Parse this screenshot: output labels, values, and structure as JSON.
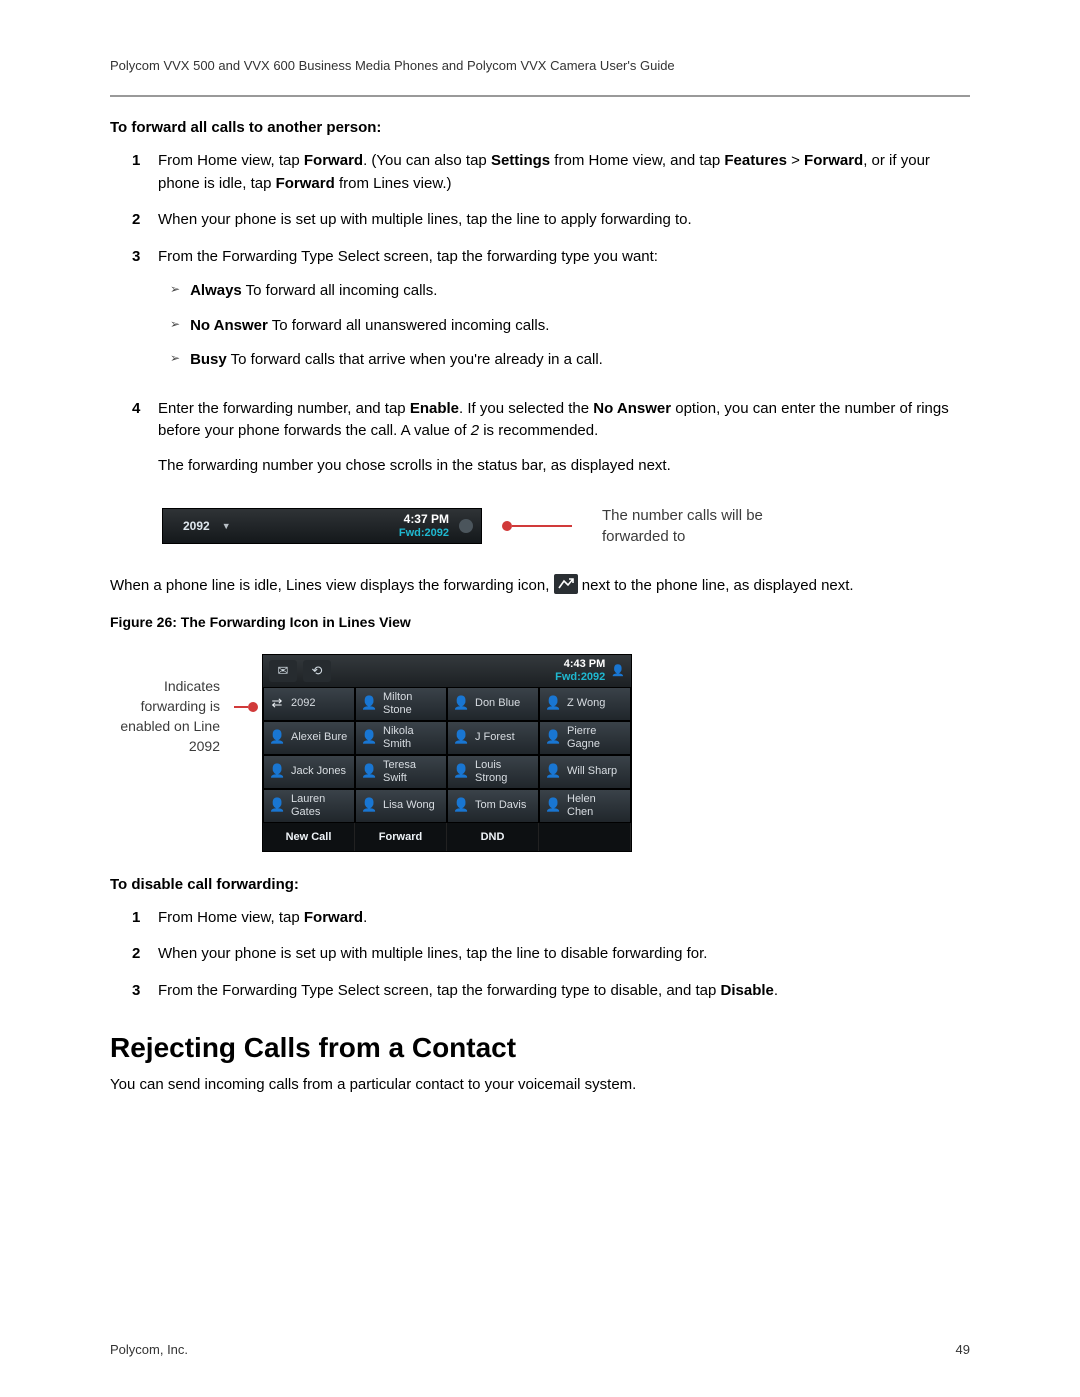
{
  "header": {
    "title": "Polycom VVX 500 and VVX 600 Business Media Phones and Polycom VVX Camera User's Guide"
  },
  "forward_enable": {
    "label": "To forward all calls to another person:",
    "step1_a": "From Home view, tap ",
    "step1_b1": "Forward",
    "step1_c": ". (You can also tap ",
    "step1_b2": "Settings",
    "step1_d": " from Home view, and tap ",
    "step1_b3": "Features",
    "step1_e": " > ",
    "step1_b4": "Forward",
    "step1_f": ", or if your phone is idle, tap ",
    "step1_b5": "Forward",
    "step1_g": " from Lines view.)",
    "step2": "When your phone is set up with multiple lines, tap the line to apply forwarding to.",
    "step3": "From the Forwarding Type Select screen, tap the forwarding type you want:",
    "sub_always_b": "Always",
    "sub_always_t": "    To forward all incoming calls.",
    "sub_noanswer_b": "No Answer",
    "sub_noanswer_t": "    To forward all unanswered incoming calls.",
    "sub_busy_b": "Busy",
    "sub_busy_t": "    To forward calls that arrive when you're already in a call.",
    "step4_a": "Enter the forwarding number, and tap ",
    "step4_b1": "Enable",
    "step4_c": ". If you selected the ",
    "step4_b2": "No Answer",
    "step4_d": " option, you can enter the number of rings before your phone forwards the call. A value of ",
    "step4_i": "2",
    "step4_e": " is recommended.",
    "step4_after": "The forwarding number you chose scrolls in the status bar, as displayed next."
  },
  "statusbar": {
    "ext": "2092",
    "time": "4:37 PM",
    "fwd": "Fwd:2092",
    "callout1": "The number calls will be",
    "callout2": "forwarded to"
  },
  "mid_para_a": "When a phone line is idle, Lines view displays the forwarding icon, ",
  "mid_para_b": " next to the phone line, as displayed next.",
  "figure_caption": "Figure 26: The Forwarding Icon in Lines View",
  "lines_callout": "Indicates forwarding is enabled on Line 2092",
  "phone": {
    "time": "4:43 PM",
    "fwd": "Fwd:2092",
    "softkeys": [
      "New Call",
      "Forward",
      "DND",
      ""
    ],
    "cells": [
      [
        "2092",
        "Milton Stone",
        "Don Blue",
        "Z Wong"
      ],
      [
        "Alexei Bure",
        "Nikola Smith",
        "J Forest",
        "Pierre Gagne"
      ],
      [
        "Jack Jones",
        "Teresa Swift",
        "Louis Strong",
        "Will Sharp"
      ],
      [
        "Lauren Gates",
        "Lisa Wong",
        "Tom Davis",
        "Helen Chen"
      ]
    ]
  },
  "forward_disable": {
    "label": "To disable call forwarding:",
    "step1_a": "From Home view, tap ",
    "step1_b": "Forward",
    "step1_c": ".",
    "step2": "When your phone is set up with multiple lines, tap the line to disable forwarding for.",
    "step3_a": "From the Forwarding Type Select screen, tap the forwarding type to disable, and tap ",
    "step3_b": "Disable",
    "step3_c": "."
  },
  "rejecting": {
    "heading": "Rejecting Calls from a Contact",
    "body": "You can send incoming calls from a particular contact to your voicemail system."
  },
  "footer": {
    "left": "Polycom, Inc.",
    "right": "49"
  }
}
